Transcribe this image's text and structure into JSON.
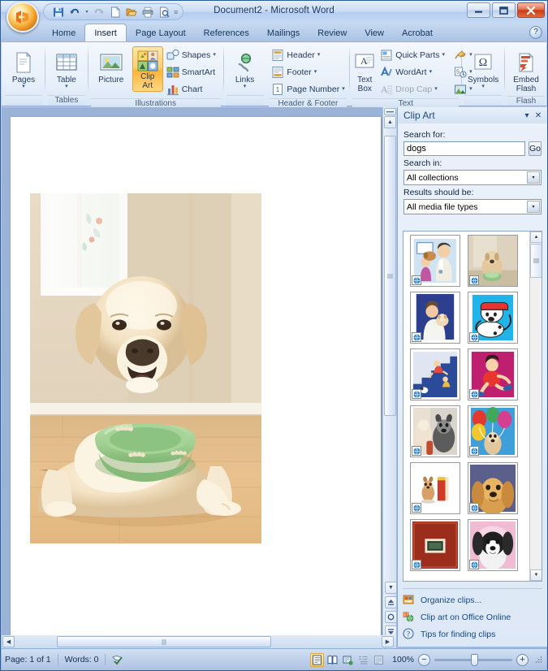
{
  "window": {
    "title": "Document2 - Microsoft Word",
    "minimize_label": "–",
    "maximize_label": "□",
    "close_label": "✕",
    "office_button": "office-orb"
  },
  "quick_access": {
    "items": [
      {
        "name": "save-button",
        "label": "Save"
      },
      {
        "name": "undo-button",
        "label": "Undo"
      },
      {
        "name": "undo-dropdown",
        "label": "▾"
      },
      {
        "name": "redo-button",
        "label": "Redo"
      },
      {
        "name": "new-button",
        "label": "New"
      },
      {
        "name": "open-button",
        "label": "Open"
      },
      {
        "name": "print-button",
        "label": "Print"
      },
      {
        "name": "print-preview-button",
        "label": "Print Preview"
      },
      {
        "name": "customize-qat-button",
        "label": "▾"
      }
    ]
  },
  "tabs": [
    {
      "label": "Home",
      "active": false
    },
    {
      "label": "Insert",
      "active": true
    },
    {
      "label": "Page Layout",
      "active": false
    },
    {
      "label": "References",
      "active": false
    },
    {
      "label": "Mailings",
      "active": false
    },
    {
      "label": "Review",
      "active": false
    },
    {
      "label": "View",
      "active": false
    },
    {
      "label": "Acrobat",
      "active": false
    }
  ],
  "help_button": "?",
  "ribbon": {
    "groups": [
      {
        "label": "",
        "items": [
          {
            "label": "Pages",
            "kind": "big"
          }
        ]
      },
      {
        "label": "Tables",
        "items": [
          {
            "label": "Table",
            "kind": "big"
          }
        ]
      },
      {
        "label": "Illustrations",
        "items": [
          {
            "label": "Picture",
            "kind": "big"
          },
          {
            "label": "Clip\nArt",
            "line1": "Clip",
            "line2": "Art",
            "kind": "big",
            "selected": true
          },
          {
            "label": "Shapes",
            "kind": "small",
            "dropdown": true
          },
          {
            "label": "SmartArt",
            "kind": "small"
          },
          {
            "label": "Chart",
            "kind": "small"
          }
        ]
      },
      {
        "label": "",
        "items": [
          {
            "label": "Links",
            "kind": "big"
          }
        ]
      },
      {
        "label": "Header & Footer",
        "items": [
          {
            "label": "Header",
            "kind": "small",
            "dropdown": true
          },
          {
            "label": "Footer",
            "kind": "small",
            "dropdown": true
          },
          {
            "label": "Page Number",
            "kind": "small",
            "dropdown": true
          }
        ]
      },
      {
        "label": "Text",
        "items": [
          {
            "label": "Text\nBox",
            "line1": "Text",
            "line2": "Box",
            "kind": "big"
          },
          {
            "label": "Quick Parts",
            "kind": "small",
            "dropdown": true
          },
          {
            "label": "WordArt",
            "kind": "small",
            "dropdown": true
          },
          {
            "label": "Drop Cap",
            "kind": "small",
            "dropdown": true,
            "disabled": true
          }
        ]
      },
      {
        "label": "",
        "items": [
          {
            "label": "Symbols",
            "kind": "big"
          }
        ]
      },
      {
        "label": "Flash",
        "items": [
          {
            "label": "Embed\nFlash",
            "line1": "Embed",
            "line2": "Flash",
            "kind": "big"
          }
        ]
      }
    ],
    "group_labels": {
      "tables": "Tables",
      "illustrations": "Illustrations",
      "header_footer": "Header & Footer",
      "text": "Text",
      "flash": "Flash"
    },
    "labels": {
      "pages": "Pages",
      "table": "Table",
      "picture": "Picture",
      "clip_art_l1": "Clip",
      "clip_art_l2": "Art",
      "shapes": "Shapes",
      "smartart": "SmartArt",
      "chart": "Chart",
      "links": "Links",
      "header": "Header",
      "footer": "Footer",
      "page_number": "Page Number",
      "text_box_l1": "Text",
      "text_box_l2": "Box",
      "quick_parts": "Quick Parts",
      "wordart": "WordArt",
      "drop_cap": "Drop Cap",
      "symbols": "Symbols",
      "embed_flash_l1": "Embed",
      "embed_flash_l2": "Flash",
      "dropdown_caret": "▾"
    }
  },
  "document": {
    "page_image_alt": "yellow labrador retriever lying on hardwood floor beside a green dog bowl"
  },
  "clip_art_pane": {
    "title": "Clip Art",
    "menu_caret": "▾",
    "close_label": "✕",
    "search_for_label": "Search for:",
    "search_value": "dogs",
    "search_placeholder": "",
    "go_label": "Go",
    "search_in_label": "Search in:",
    "search_in_value": "All collections",
    "results_label": "Results should be:",
    "results_value": "All media file types",
    "dropdown_caret": "▾",
    "scroll_up": "▲",
    "scroll_down": "▼",
    "results": [
      {
        "name": "vet-with-dog-and-child",
        "alt": "veterinarian with child holding dog",
        "badge": true
      },
      {
        "name": "dog-at-door",
        "alt": "photo of dog standing at glass door",
        "badge": true
      },
      {
        "name": "vet-holding-dog",
        "alt": "vet in white coat holding small dog",
        "badge": true
      },
      {
        "name": "cartoon-dog-blue",
        "alt": "cartoon dog with hat on blue background",
        "badge": true
      },
      {
        "name": "kids-on-stairs",
        "alt": "cartoon children and dog on stairs",
        "badge": true
      },
      {
        "name": "running-child-magenta",
        "alt": "cartoon child running on magenta background",
        "badge": true
      },
      {
        "name": "puppy-with-toy",
        "alt": "photo of puppies with a toy",
        "badge": true
      },
      {
        "name": "dog-with-balloons",
        "alt": "photo of dog with colorful balloons",
        "badge": true
      },
      {
        "name": "dog-beside-book",
        "alt": "small dog sitting beside a red book",
        "badge": true
      },
      {
        "name": "cocker-spaniel",
        "alt": "golden cocker spaniel portrait",
        "badge": true
      },
      {
        "name": "red-photo-frame",
        "alt": "red album with small photo",
        "badge": true
      },
      {
        "name": "black-white-puppy",
        "alt": "black and white fluffy puppy on pink background",
        "badge": true
      }
    ],
    "links": [
      {
        "label": "Organize clips...",
        "icon": "organize-clips-icon"
      },
      {
        "label": "Clip art on Office Online",
        "icon": "office-online-icon"
      },
      {
        "label": "Tips for finding clips",
        "icon": "help-tips-icon"
      }
    ]
  },
  "status_bar": {
    "page_text": "Page: 1 of 1",
    "words_text": "Words: 0",
    "proofing_icon": "proofing-errors-icon",
    "view_buttons": [
      {
        "name": "print-layout-view",
        "label": "Print Layout",
        "active": true
      },
      {
        "name": "full-screen-reading-view",
        "label": "Full Screen Reading",
        "active": false
      },
      {
        "name": "web-layout-view",
        "label": "Web Layout",
        "active": false
      },
      {
        "name": "outline-view",
        "label": "Outline",
        "active": false
      },
      {
        "name": "draft-view",
        "label": "Draft",
        "active": false
      }
    ],
    "zoom_level": "100%",
    "zoom_out_label": "−",
    "zoom_in_label": "+"
  },
  "colors": {
    "accent_blue": "#1c4a7d",
    "ribbon_selected": "#ffb53b",
    "link_blue": "#0f4a8a",
    "titlebar_text": "#1b3a63"
  }
}
